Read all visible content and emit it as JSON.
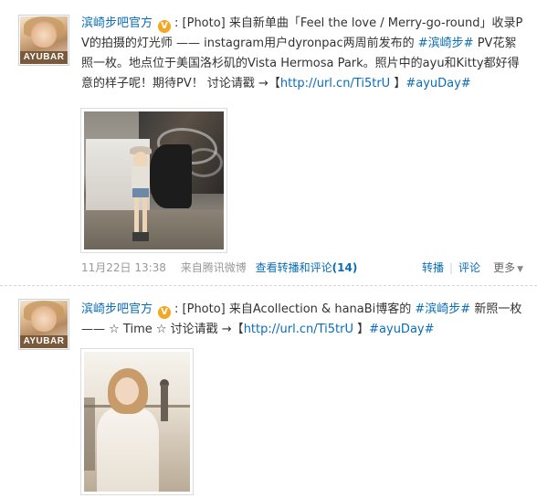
{
  "posts": [
    {
      "avatar_text": "AYUBAR",
      "username": "滨崎步吧官方",
      "verified_badge": "V",
      "body_segments": [
        {
          "t": ": [Photo] 来自新单曲「Feel the love / Merry-go-round」收录PV的拍摄的灯光师 —— instagram用户dyronpac两周前发布的 ",
          "type": "text"
        },
        {
          "t": "#滨崎步#",
          "type": "topic"
        },
        {
          "t": " PV花絮照一枚。地点位于美国洛杉矶的Vista Hermosa Park。照片中的ayu和Kitty都好得意的样子呢！期待PV！ 讨论请戳 →【",
          "type": "text"
        },
        {
          "t": "http://url.cn/Ti5trU",
          "type": "link"
        },
        {
          "t": " 】",
          "type": "text"
        },
        {
          "t": "#ayuDay#",
          "type": "topic"
        }
      ],
      "time": "11月22日 13:38",
      "source_prefix": "来自",
      "source": "腾讯微博",
      "view_label": "查看转播和评论",
      "view_count": "(14)",
      "action_repost": "转播",
      "action_comment": "评论",
      "action_more": "更多"
    },
    {
      "avatar_text": "AYUBAR",
      "username": "滨崎步吧官方",
      "verified_badge": "V",
      "body_segments": [
        {
          "t": ": [Photo] 来自Acollection & hanaBi博客的 ",
          "type": "text"
        },
        {
          "t": "#滨崎步#",
          "type": "topic"
        },
        {
          "t": " 新照一枚 —— ☆ Time ☆ 讨论请戳 →【",
          "type": "text"
        },
        {
          "t": "http://url.cn/Ti5trU",
          "type": "link"
        },
        {
          "t": " 】",
          "type": "text"
        },
        {
          "t": "#ayuDay#",
          "type": "topic"
        }
      ]
    }
  ],
  "icons": {
    "verified": "verified-badge-icon",
    "more_triangle": "chevron-down-icon"
  },
  "colors": {
    "link": "#0a6db7",
    "meta": "#999999",
    "badge": "#f5a623"
  }
}
